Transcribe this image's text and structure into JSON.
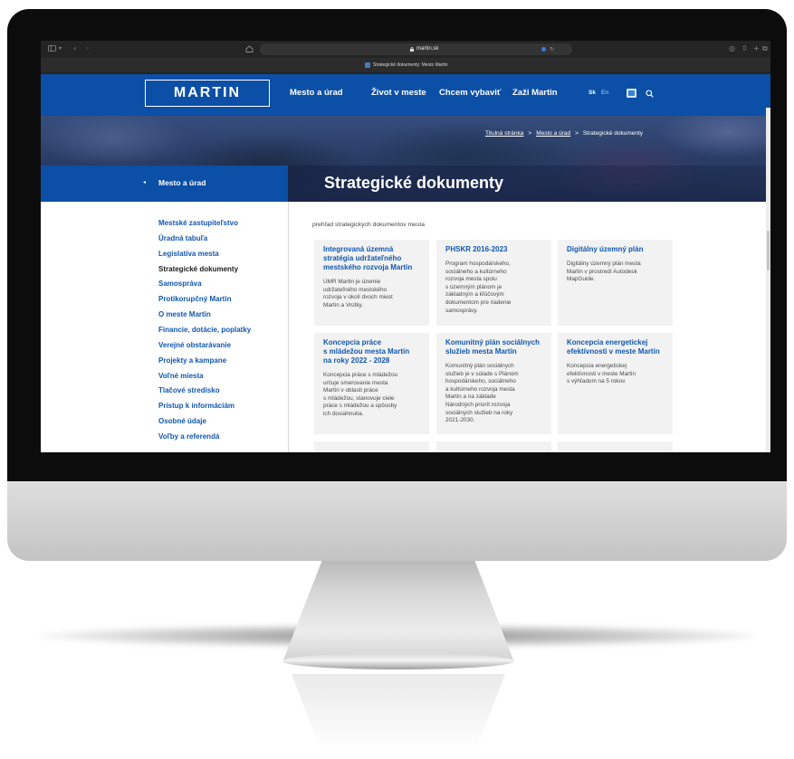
{
  "browser": {
    "url": "martin.sk",
    "tab_title": "Strategické dokumenty: Mesto Martin"
  },
  "header": {
    "logo": "MARTIN",
    "nav": [
      "Mesto a úrad",
      "Život v meste",
      "Chcem vybaviť",
      "Zaži Martin"
    ],
    "lang_sk": "Sk",
    "lang_en": "En"
  },
  "breadcrumb": {
    "items": [
      "Titulná stránka",
      "Mesto a úrad",
      "Strategické dokumenty"
    ],
    "separator": ">"
  },
  "section": {
    "back_label": "Mesto a úrad",
    "title": "Strategické dokumenty",
    "intro": "prehľad strategických dokumentov mesta"
  },
  "sidebar": {
    "items": [
      {
        "label": "Mestské zastupiteľstvo",
        "active": false
      },
      {
        "label": "Úradná tabuľa",
        "active": false
      },
      {
        "label": "Legislatíva mesta",
        "active": false
      },
      {
        "label": "Strategické dokumenty",
        "active": true
      },
      {
        "label": "Samospráva",
        "active": false
      },
      {
        "label": "Protikorupčný Martin",
        "active": false
      },
      {
        "label": "O meste Martin",
        "active": false
      },
      {
        "label": "Financie, dotácie, poplatky",
        "active": false
      },
      {
        "label": "Verejné obstarávanie",
        "active": false
      },
      {
        "label": "Projekty a kampane",
        "active": false
      },
      {
        "label": "Voľné miesta",
        "active": false
      },
      {
        "label": "Tlačové stredisko",
        "active": false
      },
      {
        "label": "Prístup k informáciám",
        "active": false
      },
      {
        "label": "Osobné údaje",
        "active": false
      },
      {
        "label": "Voľby a referendá",
        "active": false
      }
    ]
  },
  "cards": [
    {
      "title_lines": [
        "Integrovaná územná",
        "stratégia udržateľného",
        "mestského rozvoja Martin"
      ],
      "description_lines": [
        "UMR Martin je územie",
        "udržateľného mestského",
        "rozvoja v okolí dvoch miest",
        "Martin a Vrútky."
      ]
    },
    {
      "title_lines": [
        "PHSKR 2016-2023"
      ],
      "description_lines": [
        "Program hospodárskeho,",
        "sociálneho a kultúrneho",
        "rozvoja mesta spolu",
        "s územným plánom je",
        "základným a kľúčovým",
        "dokumentom pre riadenie",
        "samosprávy."
      ]
    },
    {
      "title_lines": [
        "Digitálny územný plán"
      ],
      "description_lines": [
        "Digitálny územný plán mesta",
        "Martin v prostredí Autodesk",
        "MapGuide."
      ]
    },
    {
      "title_lines": [
        "Koncepcia práce",
        "s mládežou mesta Martin",
        "na roky 2022 - 2028"
      ],
      "description_lines": [
        "Koncepcia práce s mládežou",
        "určuje smerovanie mesta",
        "Martin v oblasti práce",
        "s mládežou, stanovuje ciele",
        "práce s mládežou a spôsoby",
        "ich dosiahnutia."
      ]
    },
    {
      "title_lines": [
        "Komunitný plán sociálnych",
        "služieb mesta Martin"
      ],
      "description_lines": [
        "Komunitný plán sociálnych",
        "služieb je v súlade s Plánom",
        "hospodárskeho, sociálneho",
        "a kultúrneho rozvoja mesta",
        "Martin a na základe",
        "Národných priorít rozvoja",
        "sociálnych služieb na roky",
        "2021-2030."
      ]
    },
    {
      "title_lines": [
        "Koncepcia energetickej",
        "efektívnosti v meste Martin"
      ],
      "description_lines": [
        "Koncepcia energetickej",
        "efektívnosti v meste Martin",
        "s výhľadom na 5 rokov."
      ]
    }
  ],
  "icons": {
    "browser_left": [
      "sidebar-toggle-icon",
      "chevron-down-icon",
      "back-icon",
      "forward-icon",
      "home-icon"
    ],
    "browser_url": [
      "lock-icon",
      "translate-icon",
      "reload-icon"
    ],
    "browser_right": [
      "download-icon",
      "share-icon",
      "new-tab-icon",
      "tabs-overview-icon"
    ],
    "header": [
      "accessibility-icon",
      "search-icon"
    ],
    "section": [
      "chevron-left-icon"
    ]
  },
  "colors": {
    "brand_blue": "#0c4fa6",
    "link_blue": "#1157b0",
    "card_background": "#f2f2f2",
    "browser_chrome": "#242424",
    "bezel": "#0c0c0c"
  }
}
